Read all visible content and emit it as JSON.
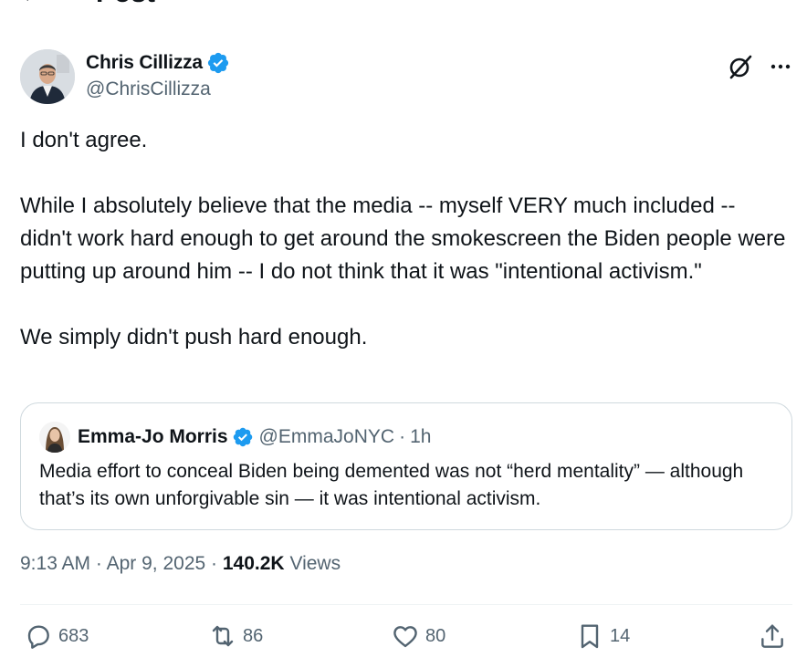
{
  "header": {
    "back_label": "←",
    "title": "Post"
  },
  "author": {
    "name": "Chris Cillizza",
    "handle": "@ChrisCillizza",
    "verified": true
  },
  "post": {
    "paragraphs": [
      "I don't agree.",
      "While I absolutely believe that the media -- myself VERY much included -- didn't work hard enough to get around the smokescreen the Biden people were putting up around him -- I do not think that it was \"intentional activism.\"",
      "We simply didn't push hard enough."
    ]
  },
  "quote": {
    "name": "Emma-Jo Morris",
    "handle": "@EmmaJoNYC",
    "separator": "·",
    "time": "1h",
    "text": "Media effort to conceal Biden being demented was not “herd mentality” — although that’s its own unforgivable sin — it was intentional activism."
  },
  "meta": {
    "time": "9:13 AM",
    "separator1": "·",
    "date": "Apr 9, 2025",
    "separator2": "·",
    "views_count": "140.2K",
    "views_label": "Views"
  },
  "actions": {
    "replies": "683",
    "reposts": "86",
    "likes": "80",
    "bookmarks": "14"
  },
  "icons": {
    "verified": "verified-badge-icon",
    "grok": "grok-icon",
    "more": "more-icon",
    "reply": "reply-icon",
    "repost": "repost-icon",
    "like": "heart-icon",
    "bookmark": "bookmark-icon",
    "share": "share-icon"
  },
  "colors": {
    "text_primary": "#0f1419",
    "text_secondary": "#536471",
    "verified_blue": "#1d9bf0",
    "border": "#cfd9de"
  }
}
